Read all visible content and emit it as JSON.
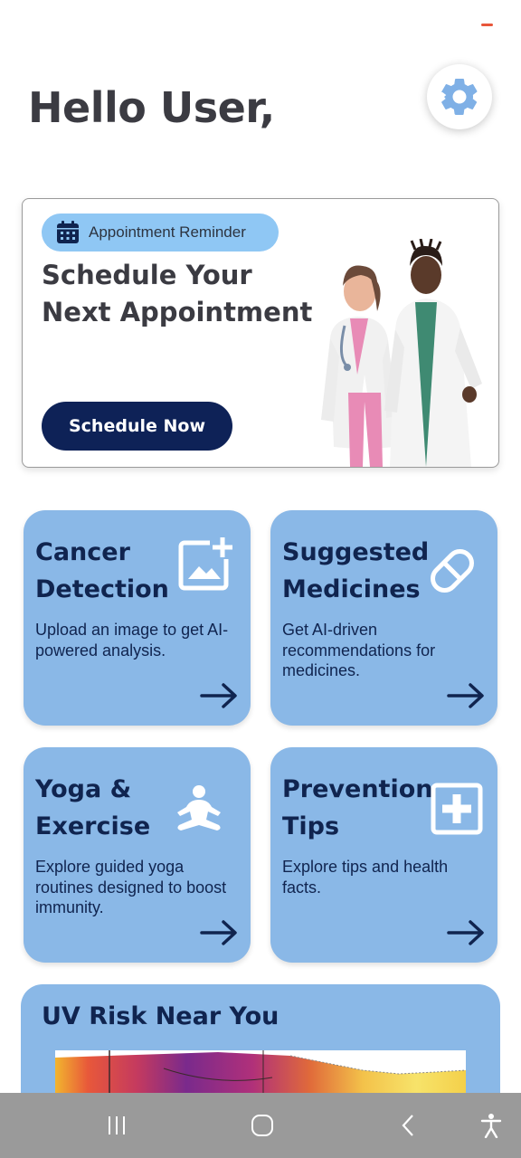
{
  "greeting": "Hello User,",
  "appointment": {
    "badge": "Appointment Reminder",
    "title": "Schedule Your Next Appointment",
    "button": "Schedule Now"
  },
  "cards": [
    {
      "title": "Cancer Detection",
      "description": "Upload an image to get AI-powered analysis.",
      "icon": "add-image-icon"
    },
    {
      "title": "Suggested Medicines",
      "description": "Get AI-driven recommendations for medicines.",
      "icon": "pill-icon"
    },
    {
      "title": "Yoga & Exercise",
      "description": "Explore guided yoga routines designed to boost immunity.",
      "icon": "meditation-icon"
    },
    {
      "title": "Prevention Tips",
      "description": "Explore tips and health facts.",
      "icon": "medical-cross-icon"
    }
  ],
  "uv": {
    "title": "UV Risk Near You"
  },
  "colors": {
    "card": "#8ab8e7",
    "card_text": "#10244f",
    "button": "#0e2257",
    "badge": "#8fc7f4",
    "settings_icon": "#7fb0e6"
  },
  "navbar": [
    "recent-apps-icon",
    "home-icon",
    "back-icon",
    "accessibility-icon"
  ]
}
